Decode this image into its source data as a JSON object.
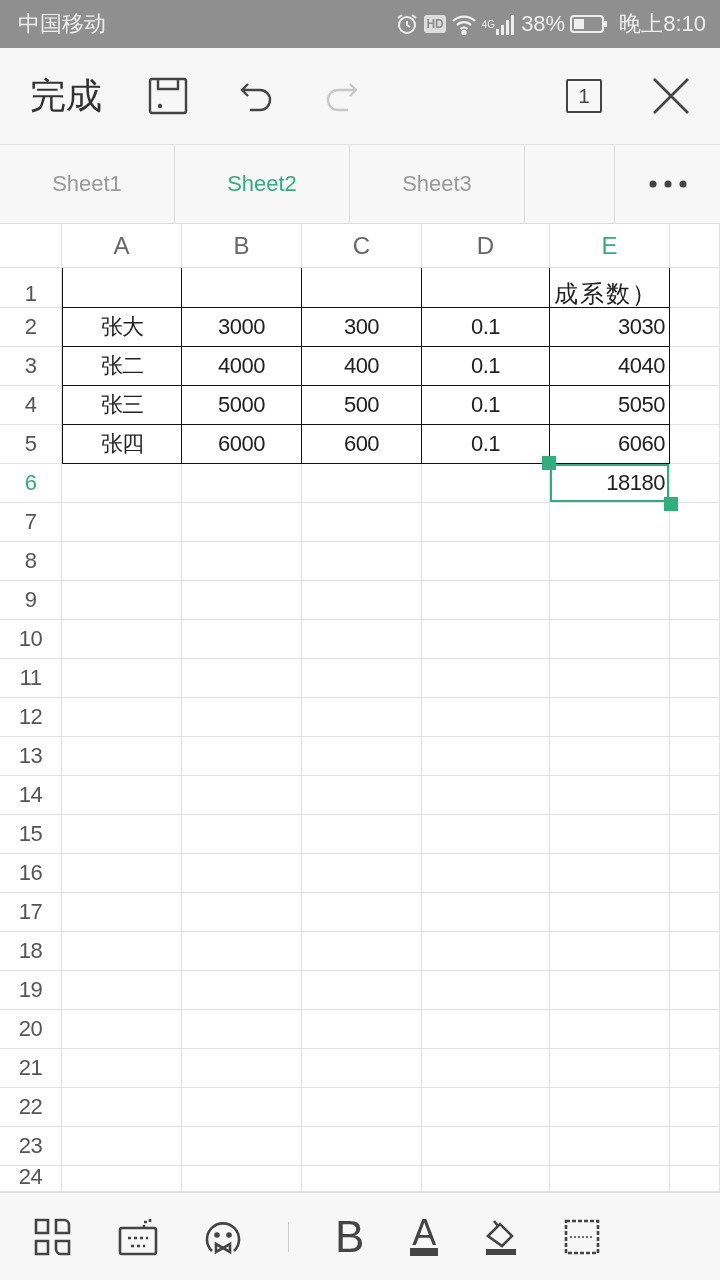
{
  "status_bar": {
    "carrier": "中国移动",
    "hd": "HD",
    "network": "4G",
    "battery": "38%",
    "time": "晚上8:10"
  },
  "toolbar": {
    "done": "完成",
    "page_count": "1"
  },
  "tabs": [
    {
      "label": "Sheet1",
      "selected": false
    },
    {
      "label": "Sheet2",
      "selected": true
    },
    {
      "label": "Sheet3",
      "selected": false
    }
  ],
  "columns": [
    {
      "label": "A",
      "selected": false
    },
    {
      "label": "B",
      "selected": false
    },
    {
      "label": "C",
      "selected": false
    },
    {
      "label": "D",
      "selected": false
    },
    {
      "label": "E",
      "selected": true
    }
  ],
  "rows": [
    {
      "number": "1",
      "selected": false,
      "bordered": true,
      "cells": {
        "E": "成系数）"
      }
    },
    {
      "number": "2",
      "selected": false,
      "bordered": true,
      "cells": {
        "A": "张大",
        "B": "3000",
        "C": "300",
        "D": "0.1",
        "E": "3030"
      }
    },
    {
      "number": "3",
      "selected": false,
      "bordered": true,
      "cells": {
        "A": "张二",
        "B": "4000",
        "C": "400",
        "D": "0.1",
        "E": "4040"
      }
    },
    {
      "number": "4",
      "selected": false,
      "bordered": true,
      "cells": {
        "A": "张三",
        "B": "5000",
        "C": "500",
        "D": "0.1",
        "E": "5050"
      }
    },
    {
      "number": "5",
      "selected": false,
      "bordered": true,
      "cells": {
        "A": "张四",
        "B": "6000",
        "C": "600",
        "D": "0.1",
        "E": "6060"
      }
    },
    {
      "number": "6",
      "selected": true,
      "bordered": false,
      "cells": {
        "E": "18180"
      }
    },
    {
      "number": "7",
      "selected": false,
      "bordered": false
    },
    {
      "number": "8",
      "selected": false,
      "bordered": false
    },
    {
      "number": "9",
      "selected": false,
      "bordered": false
    },
    {
      "number": "10",
      "selected": false,
      "bordered": false
    },
    {
      "number": "11",
      "selected": false,
      "bordered": false
    },
    {
      "number": "12",
      "selected": false,
      "bordered": false
    },
    {
      "number": "13",
      "selected": false,
      "bordered": false
    },
    {
      "number": "14",
      "selected": false,
      "bordered": false
    },
    {
      "number": "15",
      "selected": false,
      "bordered": false
    },
    {
      "number": "16",
      "selected": false,
      "bordered": false
    },
    {
      "number": "17",
      "selected": false,
      "bordered": false
    },
    {
      "number": "18",
      "selected": false,
      "bordered": false
    },
    {
      "number": "19",
      "selected": false,
      "bordered": false
    },
    {
      "number": "20",
      "selected": false,
      "bordered": false
    },
    {
      "number": "21",
      "selected": false,
      "bordered": false
    },
    {
      "number": "22",
      "selected": false,
      "bordered": false
    },
    {
      "number": "23",
      "selected": false,
      "bordered": false
    },
    {
      "number": "24",
      "selected": false,
      "bordered": false
    }
  ],
  "format_bar": {
    "bold": "B",
    "font_color": "A"
  }
}
